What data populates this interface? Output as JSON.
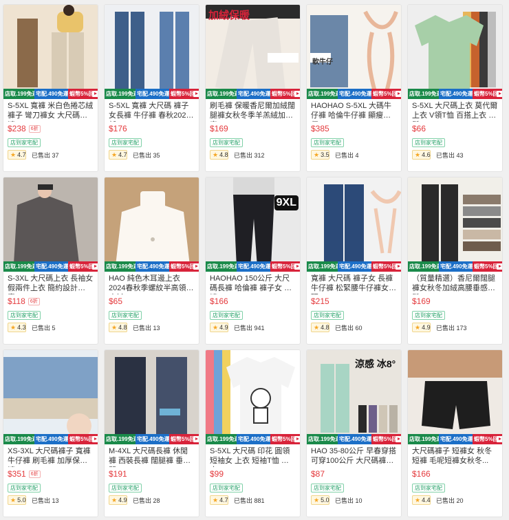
{
  "promo": {
    "p1": "店取.199免運",
    "p2": "宅配.490免運",
    "p3": "蝦幣5%回饋"
  },
  "products": [
    {
      "title": "S-5XL 寬褲 米白色捲芯絨褲子 彎刀褲女 大尺碼長褲 ...",
      "price": "$238",
      "badge": "6折",
      "shipping": "店到家宅配",
      "rating": "4.7",
      "sold": "已售出 37",
      "overlay": ""
    },
    {
      "title": "S-5XL 寬褲 大尺碼 褲子女長褲 牛仔褲 春秋2022新...",
      "price": "$176",
      "badge": "",
      "shipping": "店到家宅配",
      "rating": "4.7",
      "sold": "已售出 35",
      "overlay": ""
    },
    {
      "title": "刷毛褲 保暖香尼爾加絨闊腿褲女秋冬季羊羔絨加厚直...",
      "price": "$169",
      "badge": "",
      "shipping": "店到家宅配",
      "rating": "4.8",
      "sold": "已售出 312",
      "overlay": "加絨保暖"
    },
    {
      "title": "HAOHAO S-5XL 大碼牛仔褲 哈倫牛仔褲 顯瘦牛仔...",
      "price": "$385",
      "badge": "",
      "shipping": "店到家宅配",
      "rating": "3.5",
      "sold": "已售出 4",
      "overlay": "軟牛仔"
    },
    {
      "title": "S-5XL 大尺碼上衣 莫代爾上衣 V領T恤 百搭上衣 寬鬆...",
      "price": "$66",
      "badge": "",
      "shipping": "店到家宅配",
      "rating": "4.6",
      "sold": "已售出 43",
      "overlay": ""
    },
    {
      "title": "S-3XL 大尺碼上衣 長袖女 假兩件上衣 簡約設計 素...",
      "price": "$118",
      "badge": "6折",
      "shipping": "店到家宅配",
      "rating": "4.3",
      "sold": "已售出 5",
      "overlay": ""
    },
    {
      "title": "HAO 純色木耳邊上衣2024春秋季螺紋半高領打底衫...",
      "price": "$65",
      "badge": "",
      "shipping": "店到家宅配",
      "rating": "4.8",
      "sold": "已售出 13",
      "overlay": ""
    },
    {
      "title": "HAOHAO 150公斤 大尺碼長褲 哈倫褲 褲子女 寬褲 ...",
      "price": "$166",
      "badge": "",
      "shipping": "店到家宅配",
      "rating": "4.9",
      "sold": "已售出 941",
      "overlay": "9XL"
    },
    {
      "title": "寬褲 大尺碼 褲子女 長褲 牛仔褲 松緊腰牛仔褲女大碼...",
      "price": "$215",
      "badge": "",
      "shipping": "店到家宅配",
      "rating": "4.8",
      "sold": "已售出 60",
      "overlay": ""
    },
    {
      "title": "（質量精選）香尼爾闊腿褲女秋冬加絨高腰垂感寬鬆...",
      "price": "$169",
      "badge": "",
      "shipping": "店到家宅配",
      "rating": "4.9",
      "sold": "已售出 173",
      "overlay": ""
    },
    {
      "title": "XS-3XL 大尺碼褲子 寬褲 牛仔褲 刷毛褲 加厚保暖褲 ...",
      "price": "$351",
      "badge": "6折",
      "shipping": "店到家宅配",
      "rating": "5.0",
      "sold": "已售出 13",
      "overlay": ""
    },
    {
      "title": "M-4XL 大尺碼長褲 休閒褲 西裝長褲 闊腿褲 垂感闊...",
      "price": "$191",
      "badge": "",
      "shipping": "店到家宅配",
      "rating": "4.9",
      "sold": "已售出 28",
      "overlay": ""
    },
    {
      "title": "S-5XL 大尺碼 印花 圓領 短袖女 上衣 短袖T恤 上衣...",
      "price": "$99",
      "badge": "",
      "shipping": "店到家宅配",
      "rating": "4.7",
      "sold": "已售出 881",
      "overlay": ""
    },
    {
      "title": "HAO 35-80公斤 早春穿搭 可穿100公斤 大尺碼褲子 ...",
      "price": "$87",
      "badge": "",
      "shipping": "店到家宅配",
      "rating": "5.0",
      "sold": "已售出 10",
      "overlay": "涼感 冰8°"
    },
    {
      "title": "大尺碼褲子 短褲女 秋冬短褲 毛呢短褲女秋冬...",
      "price": "$166",
      "badge": "",
      "shipping": "店到家宅配",
      "rating": "4.4",
      "sold": "已售出 20",
      "overlay": ""
    }
  ],
  "thumbs": [
    {
      "bg": "#efe3d1",
      "c1": "#8b6a4a",
      "c2": "#e9c36a",
      "kind": "pants-pair"
    },
    {
      "bg": "#eef0f3",
      "c1": "#3e5f8a",
      "c2": "#5b7fae",
      "kind": "jeans"
    },
    {
      "bg": "#f2ece4",
      "c1": "#e7e2dc",
      "c2": "#2b2b2b",
      "kind": "fleece"
    },
    {
      "bg": "#f6f3ee",
      "c1": "#6b87a8",
      "c2": "#e8b79a",
      "kind": "diagram"
    },
    {
      "bg": "#eeeeee",
      "c1": "#a7cfa8",
      "c2": "#d8a23e",
      "kind": "tops"
    },
    {
      "bg": "#d9d4cf",
      "c1": "#5b5656",
      "c2": "#2b2b2b",
      "kind": "cardigan"
    },
    {
      "bg": "#c5a27a",
      "c1": "#fbf7f1",
      "c2": "#2b2b2b",
      "kind": "turtleneck"
    },
    {
      "bg": "#e9e9e9",
      "c1": "#1f1f24",
      "c2": "#c0c0c0",
      "kind": "leggings"
    },
    {
      "bg": "#f2f2f2",
      "c1": "#2c4a78",
      "c2": "#f0c8b0",
      "kind": "widejeans"
    },
    {
      "bg": "#f1efe9",
      "c1": "#2a2a2a",
      "c2": "#8a8a8a",
      "kind": "chenille"
    },
    {
      "bg": "#e8eef3",
      "c1": "#7fa1c6",
      "c2": "#d9cdb8",
      "kind": "cuff"
    },
    {
      "bg": "#d8d3cc",
      "c1": "#2a3142",
      "c2": "#44506a",
      "kind": "widepants"
    },
    {
      "bg": "#ffffff",
      "c1": "#f4f4f4",
      "c2": "#333333",
      "kind": "tee"
    },
    {
      "bg": "#e9e5de",
      "c1": "#a8d5c4",
      "c2": "#cfc6b6",
      "kind": "cool"
    },
    {
      "bg": "#efeae4",
      "c1": "#1e1e1e",
      "c2": "#c79a77",
      "kind": "shorts"
    }
  ]
}
